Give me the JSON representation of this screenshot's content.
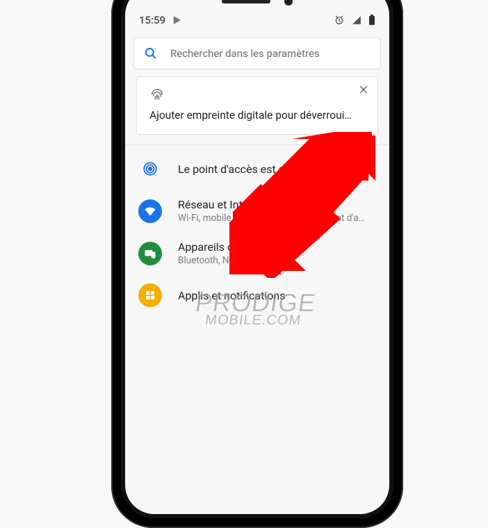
{
  "statusbar": {
    "time": "15:59"
  },
  "search": {
    "placeholder": "Rechercher dans les paramètres"
  },
  "suggestion": {
    "text": "Ajouter empreinte digitale pour déverrouil…"
  },
  "hotspot": {
    "title": "Le point d'accès est actif"
  },
  "settings": [
    {
      "title": "Réseau et Internet",
      "subtitle": "Wi-Fi, mobile, conso. des données, point d'a…"
    },
    {
      "title": "Appareils connectés",
      "subtitle": "Bluetooth, NFC"
    },
    {
      "title": "Applis et notifications",
      "subtitle": ""
    }
  ],
  "watermark": {
    "line1": "PRODIGE",
    "line2": "MOBILE.COM"
  }
}
